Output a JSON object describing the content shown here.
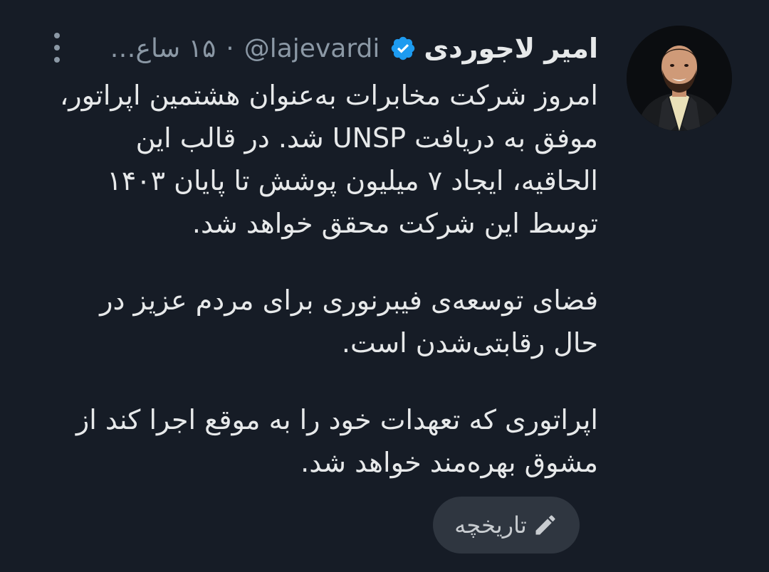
{
  "tweet": {
    "author": {
      "display_name": "امیر لاجوردی",
      "handle": "@lajevardi",
      "verified": true
    },
    "separator": "·",
    "timestamp": "۱۵ ساع…",
    "paragraphs": [
      "امروز شرکت مخابرات به‌عنوان هشتمین اپراتور، موفق به دریافت UNSP شد. در قالب این الحاقیه، ایجاد ۷ میلیون پوشش تا پایان ۱۴۰۳ توسط این شرکت محقق خواهد شد.",
      "فضای توسعه‌ی فیبرنوری برای مردم عزیز در حال رقابتی‌شدن است.",
      "اپراتوری که تعهدات خود را به موقع اجرا کند از مشوق بهره‌مند خواهد شد."
    ],
    "history_button_label": "تاریخچه"
  },
  "icons": {
    "verified": "verified-badge-icon",
    "more": "more-vertical-icon",
    "history": "pencil-icon"
  },
  "colors": {
    "background": "#161c26",
    "text_primary": "#e7e9ea",
    "text_secondary": "#8b98a5",
    "verified_blue": "#1d9bf0",
    "button_bg": "#2f3640"
  }
}
